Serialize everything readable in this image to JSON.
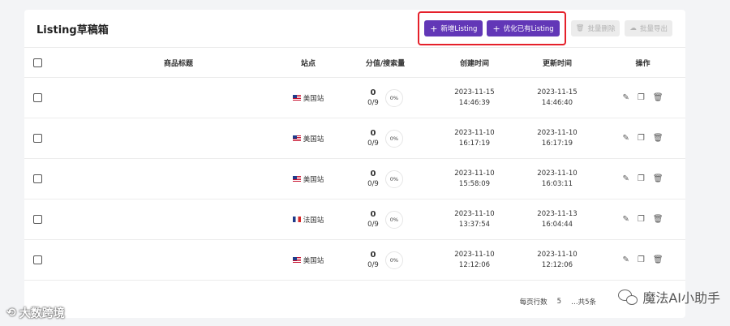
{
  "header": {
    "title": "Listing草稿箱",
    "buttons": {
      "add_listing": "新增Listing",
      "optimize_listing": "优化已有Listing",
      "batch_delete": "批量删除",
      "batch_export": "批量导出"
    }
  },
  "table": {
    "columns": {
      "title": "商品标题",
      "site": "站点",
      "score": "分值/搜索量",
      "created": "创建时间",
      "updated": "更新时间",
      "ops": "操作"
    },
    "rows": [
      {
        "site": "美国站",
        "flag": "us",
        "score": "0",
        "search": "0/9",
        "pct": "0%",
        "created_date": "2023-11-15",
        "created_time": "14:46:39",
        "updated_date": "2023-11-15",
        "updated_time": "14:46:40"
      },
      {
        "site": "美国站",
        "flag": "us",
        "score": "0",
        "search": "0/9",
        "pct": "0%",
        "created_date": "2023-11-10",
        "created_time": "16:17:19",
        "updated_date": "2023-11-10",
        "updated_time": "16:17:19"
      },
      {
        "site": "美国站",
        "flag": "us",
        "score": "0",
        "search": "0/9",
        "pct": "0%",
        "created_date": "2023-11-10",
        "created_time": "15:58:09",
        "updated_date": "2023-11-10",
        "updated_time": "16:03:11"
      },
      {
        "site": "法国站",
        "flag": "fr",
        "score": "0",
        "search": "0/9",
        "pct": "0%",
        "created_date": "2023-11-10",
        "created_time": "13:37:54",
        "updated_date": "2023-11-13",
        "updated_time": "16:04:44"
      },
      {
        "site": "美国站",
        "flag": "us",
        "score": "0",
        "search": "0/9",
        "pct": "0%",
        "created_date": "2023-11-10",
        "created_time": "12:12:06",
        "updated_date": "2023-11-10",
        "updated_time": "12:12:06"
      }
    ]
  },
  "footer": {
    "rows_per_page_label": "每页行数",
    "rows_per_page_value": "5",
    "pager_tail": "…共5条"
  },
  "watermarks": {
    "right": "魔法AI小助手",
    "left": "大数跨境"
  },
  "colors": {
    "primary": "#6237b7",
    "highlight_border": "#e5202a"
  }
}
